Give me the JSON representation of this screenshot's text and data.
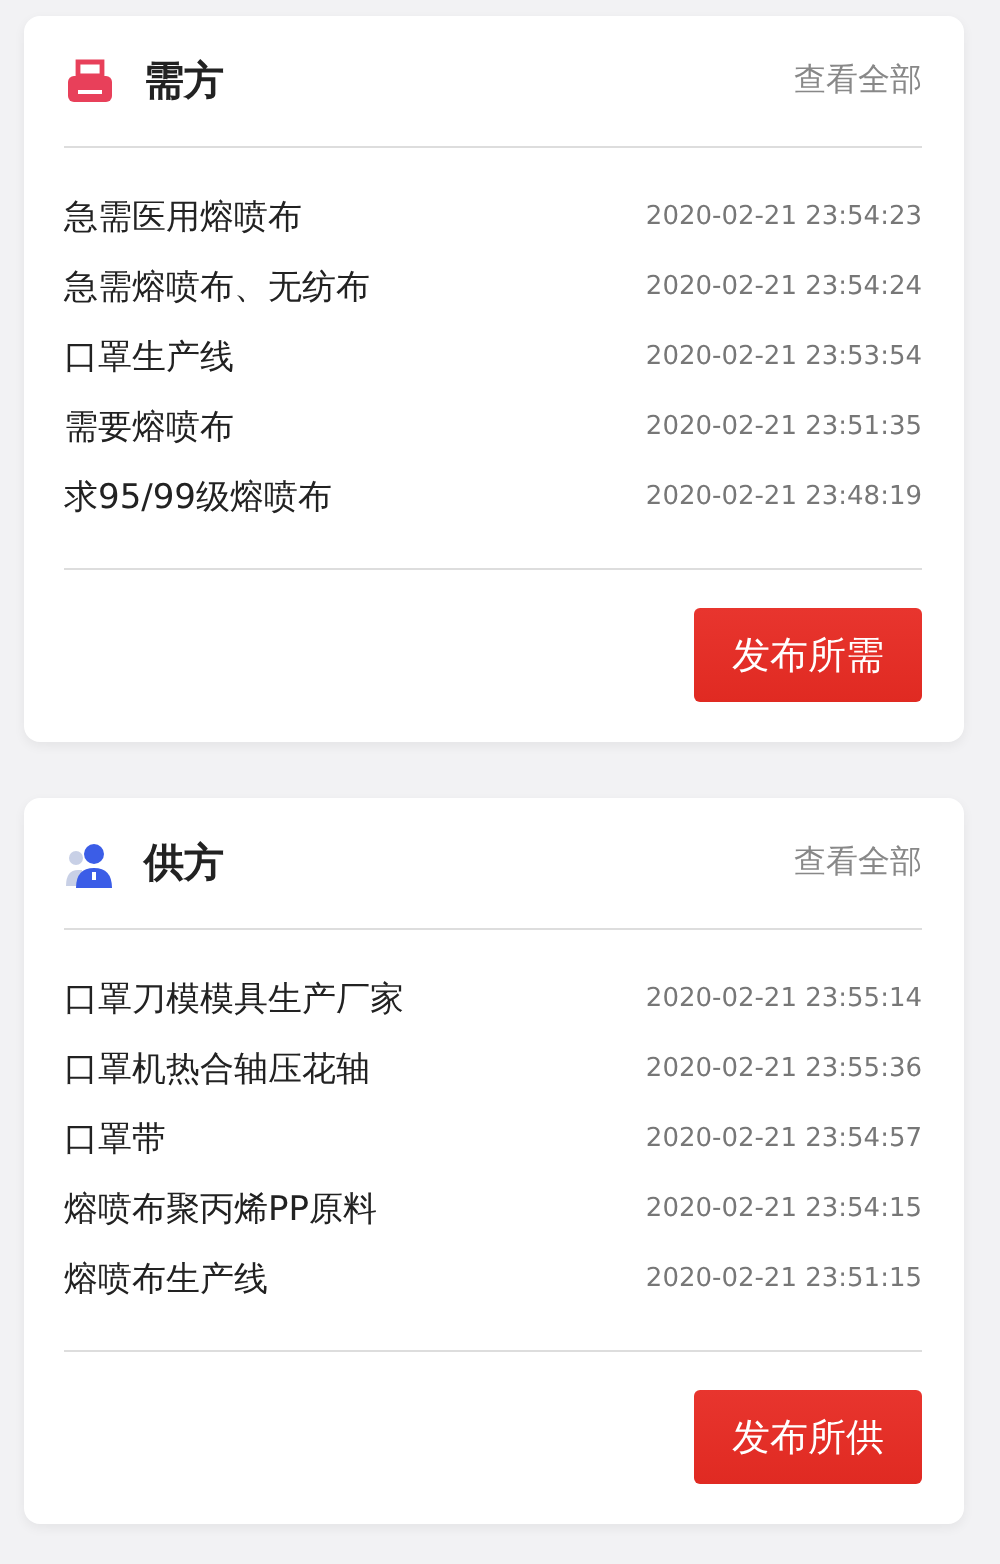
{
  "cards": [
    {
      "kind": "printer",
      "title": "需方",
      "more": "查看全部",
      "items": [
        {
          "text": "急需医用熔喷布",
          "time": "2020-02-21 23:54:23"
        },
        {
          "text": "急需熔喷布、无纺布",
          "time": "2020-02-21 23:54:24"
        },
        {
          "text": "口罩生产线",
          "time": "2020-02-21 23:53:54"
        },
        {
          "text": "需要熔喷布",
          "time": "2020-02-21 23:51:35"
        },
        {
          "text": "求95/99级熔喷布",
          "time": "2020-02-21 23:48:19"
        }
      ],
      "button": "发布所需"
    },
    {
      "kind": "person",
      "title": "供方",
      "more": "查看全部",
      "items": [
        {
          "text": "口罩刀模模具生产厂家",
          "time": "2020-02-21 23:55:14"
        },
        {
          "text": "口罩机热合轴压花轴",
          "time": "2020-02-21 23:55:36"
        },
        {
          "text": "口罩带",
          "time": "2020-02-21 23:54:57"
        },
        {
          "text": "熔喷布聚丙烯PP原料",
          "time": "2020-02-21 23:54:15"
        },
        {
          "text": "熔喷布生产线",
          "time": "2020-02-21 23:51:15"
        }
      ],
      "button": "发布所供"
    }
  ]
}
